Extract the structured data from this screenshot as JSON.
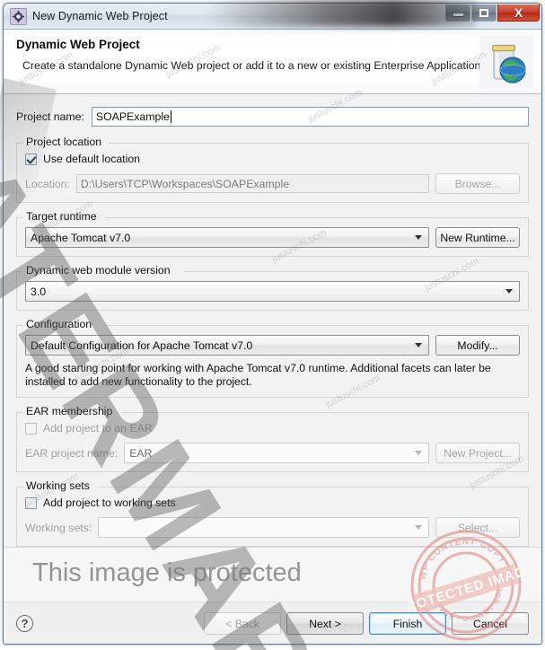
{
  "window": {
    "title": "New Dynamic Web Project",
    "app_icon": "gear-icon",
    "minimize_label": "Minimize",
    "maximize_label": "Maximize",
    "close_label": "X"
  },
  "header": {
    "title": "Dynamic Web Project",
    "subtitle": "Create a standalone Dynamic Web project or add it to a new or existing Enterprise Application.",
    "icon": "jar-globe-icon"
  },
  "form": {
    "project_name": {
      "label": "Project name:",
      "value": "SOAPExample"
    },
    "project_location": {
      "legend": "Project location",
      "use_default_label": "Use default location",
      "use_default_checked": true,
      "location_label": "Location:",
      "location_value": "D:\\Users\\TCP\\Workspaces\\SOAPExample",
      "browse_label": "Browse..."
    },
    "target_runtime": {
      "legend": "Target runtime",
      "value": "Apache Tomcat v7.0",
      "new_runtime_label": "New Runtime..."
    },
    "module_version": {
      "legend": "Dynamic web module version",
      "value": "3.0"
    },
    "configuration": {
      "legend": "Configuration",
      "value": "Default Configuration for Apache Tomcat v7.0",
      "modify_label": "Modify...",
      "description_line1": "A good starting point for working with Apache Tomcat v7.0 runtime. Additional facets can later be",
      "description_line2": "installed to add new functionality to the project."
    },
    "ear_membership": {
      "legend": "EAR membership",
      "add_to_ear_label": "Add project to an EAR",
      "add_to_ear_checked": false,
      "ear_project_name_label": "EAR project name:",
      "ear_project_name_value": "EAR",
      "new_project_label": "New Project..."
    },
    "working_sets": {
      "legend": "Working sets",
      "add_label": "Add project to working sets",
      "add_checked": false,
      "working_sets_label": "Working sets:",
      "working_sets_value": "",
      "select_label": "Select..."
    }
  },
  "buttons": {
    "help": "?",
    "back": "< Back",
    "next": "Next >",
    "finish": "Finish",
    "cancel": "Cancel"
  },
  "watermarks": {
    "diagonal": "WATERMARK",
    "protected_text": "This image is protected",
    "tile_text": "justuschi.com",
    "stamp_outer_top": "WP CONTENT COPY PROTECTION PLUGIN",
    "stamp_banner": "PROTECTED IMAGE",
    "stamp_inner": "Website - DO NOT COPY"
  },
  "colors": {
    "accent": "#3c8bc4",
    "close_button": "#c93f28",
    "field_border": "#7d9cb4",
    "stamp": "#e08b85"
  }
}
